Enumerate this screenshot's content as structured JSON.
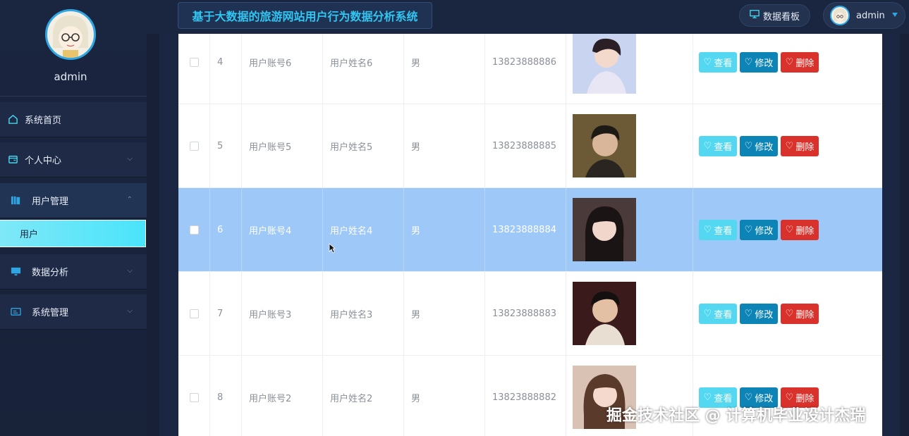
{
  "sidebar": {
    "username": "admin",
    "menu": [
      {
        "label": "系统首页",
        "icon": "home-icon"
      },
      {
        "label": "个人中心",
        "icon": "folder-icon"
      },
      {
        "label": "用户管理",
        "icon": "books-icon"
      },
      {
        "label": "数据分析",
        "icon": "monitor-icon"
      },
      {
        "label": "系统管理",
        "icon": "form-icon"
      }
    ],
    "submenu_active": "用户"
  },
  "header": {
    "title": "基于大数据的旅游网站用户行为数据分析系统",
    "dashboard_label": "数据看板",
    "user_label": "admin"
  },
  "table": {
    "rows": [
      {
        "index": "4",
        "account": "用户账号6",
        "name": "用户姓名6",
        "sex": "男",
        "phone": "13823888886",
        "selected": false
      },
      {
        "index": "5",
        "account": "用户账号5",
        "name": "用户姓名5",
        "sex": "男",
        "phone": "13823888885",
        "selected": false
      },
      {
        "index": "6",
        "account": "用户账号4",
        "name": "用户姓名4",
        "sex": "男",
        "phone": "13823888884",
        "selected": true
      },
      {
        "index": "7",
        "account": "用户账号3",
        "name": "用户姓名3",
        "sex": "男",
        "phone": "13823888883",
        "selected": false
      },
      {
        "index": "8",
        "account": "用户账号2",
        "name": "用户姓名2",
        "sex": "男",
        "phone": "13823888882",
        "selected": false
      }
    ],
    "actions": {
      "view": "查看",
      "edit": "修改",
      "delete": "删除"
    }
  },
  "watermark": "掘金技术社区 @ 计算机毕业设计杰瑞",
  "colors": {
    "accent": "#4ae4fb",
    "view": "#54d8f2",
    "edit": "#0d84b6",
    "delete": "#d9312b",
    "selected_row": "#9ec8f8"
  }
}
